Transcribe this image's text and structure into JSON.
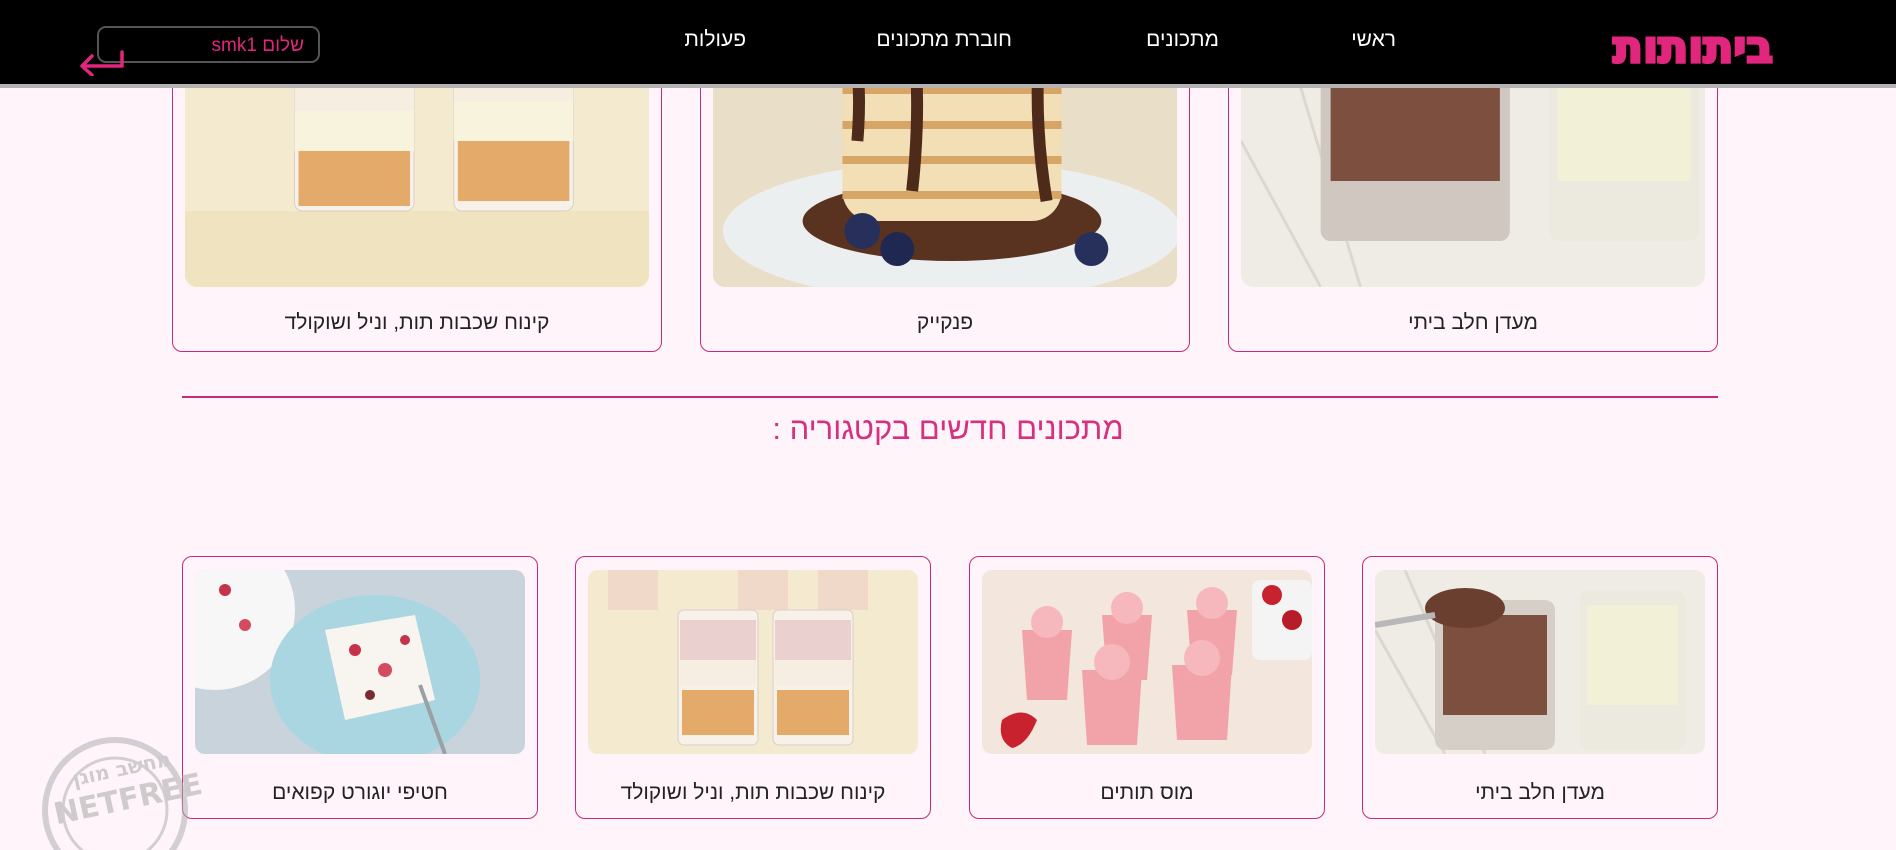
{
  "header": {
    "logo_text": "ביתותות",
    "nav": [
      "ראשי",
      "מתכונים",
      "חוברת מתכונים",
      "פעולות"
    ],
    "greeting": "שלום smk1"
  },
  "top_cards": [
    {
      "caption": "קינוח שכבות תות, וניל ושוקולד",
      "image": "layered-dessert-cups"
    },
    {
      "caption": "פנקייק",
      "image": "pancakes-with-chocolate"
    },
    {
      "caption": "מעדן חלב ביתי",
      "image": "milk-pudding-glasses"
    }
  ],
  "section": {
    "title": "מתכונים חדשים בקטגוריה :"
  },
  "cards": [
    {
      "caption": "חטיפי יוגורט קפואים",
      "image": "frozen-yogurt-bark"
    },
    {
      "caption": "קינוח שכבות תות, וניל ושוקולד",
      "image": "layered-dessert-cups"
    },
    {
      "caption": "מוס תותים",
      "image": "strawberry-mousse"
    },
    {
      "caption": "מעדן חלב ביתי",
      "image": "milk-pudding-glasses"
    }
  ],
  "watermark": {
    "text": "NETFREE",
    "sub": "מחשב מוגן"
  },
  "colors": {
    "accent": "#d6317f",
    "background": "#fff4fa",
    "header": "#000000"
  }
}
